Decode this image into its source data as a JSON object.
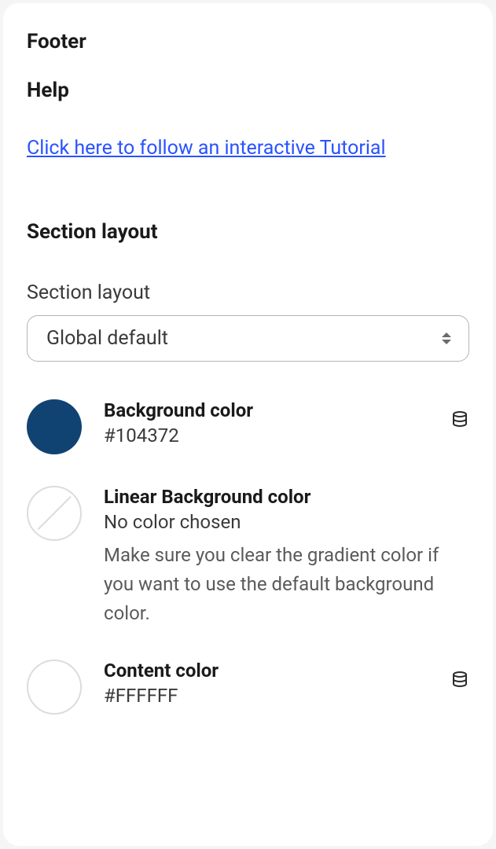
{
  "title": "Footer",
  "help": {
    "heading": "Help",
    "link_text": "Click here to follow an interactive Tutorial"
  },
  "section_layout": {
    "heading": "Section layout",
    "field_label": "Section layout",
    "selected_value": "Global default"
  },
  "colors": {
    "background": {
      "label": "Background color",
      "value": "#104372",
      "swatch": "#104372"
    },
    "linear_background": {
      "label": "Linear Background color",
      "value": "No color chosen",
      "help": "Make sure you clear the gradient color if you want to use the default background color."
    },
    "content": {
      "label": "Content color",
      "value": "#FFFFFF",
      "swatch": "#FFFFFF"
    }
  }
}
